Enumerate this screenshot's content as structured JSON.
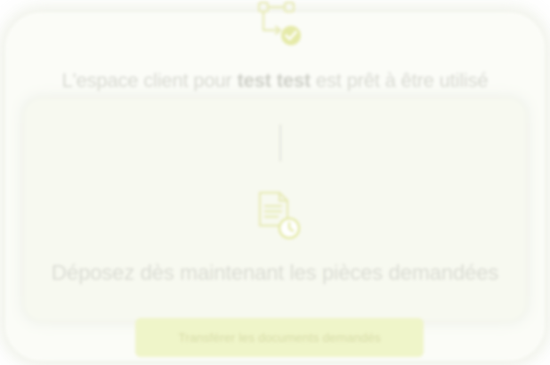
{
  "header": {
    "title_prefix": "L'espace client pour ",
    "client_name": "test test",
    "title_suffix": " est prêt à être utilisé",
    "icon": "workflow-check-icon"
  },
  "upload_section": {
    "icon": "document-clock-icon",
    "title": "Déposez dès maintenant les pièces demandées",
    "button_label": "Transférer les documents demandés"
  },
  "colors": {
    "accent": "#e5eaa8",
    "button_bg": "#eef4c4",
    "text_muted": "#d4d6cd"
  }
}
